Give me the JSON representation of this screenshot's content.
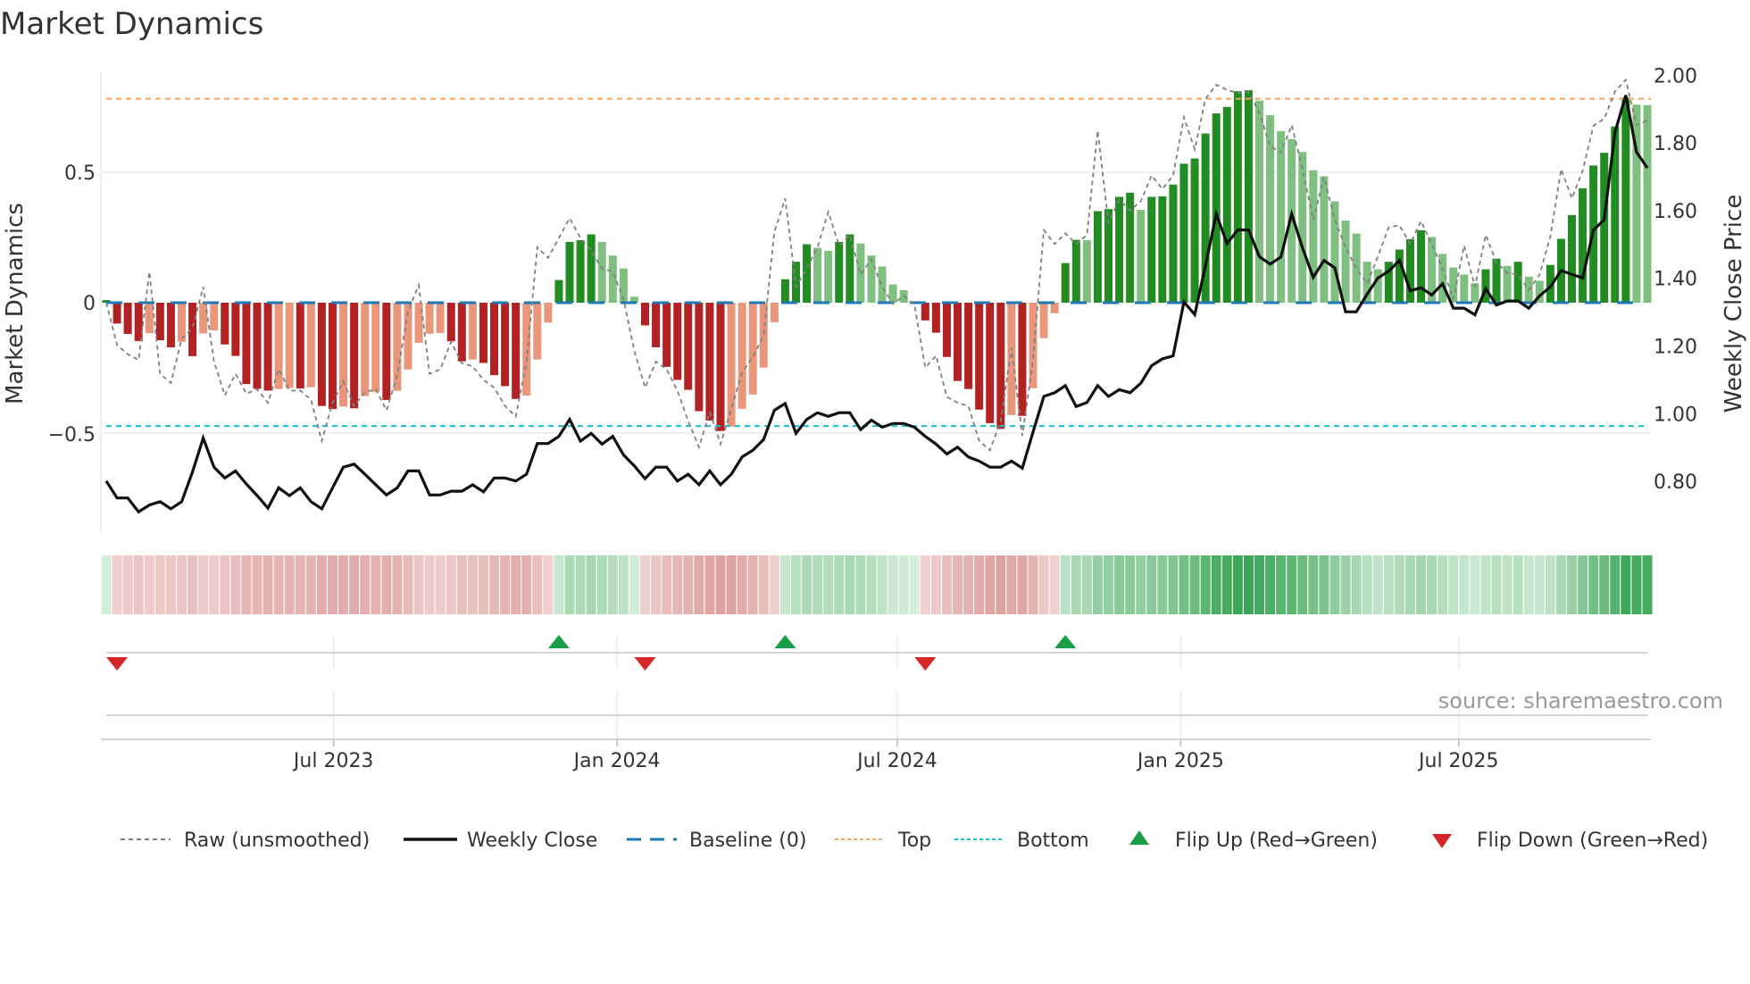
{
  "title": "Market Dynamics",
  "source": "source: sharemaestro.com",
  "colors": {
    "pos_strong": "#228b22",
    "pos_weak": "#7fbf7f",
    "neg_strong": "#b22222",
    "neg_weak": "#e9967a",
    "raw": "#808080",
    "close": "#111111",
    "baseline": "#1f77b4",
    "top": "#f4a460",
    "bottom": "#17becf",
    "flip_up": "#1a9e48",
    "flip_down": "#d62728"
  },
  "chart_data": {
    "type": "bar",
    "title": "Market Dynamics",
    "ylabel": "Market Dynamics",
    "y2label": "Weekly Close Price",
    "ylim": [
      -0.82,
      0.89
    ],
    "y2lim": [
      0.64,
      2.04
    ],
    "yticks": [
      "0.5",
      "0",
      "−0.5"
    ],
    "ytick_values": [
      0.5,
      0,
      -0.5
    ],
    "y2ticks": [
      "2.00",
      "1.80",
      "1.60",
      "1.40",
      "1.20",
      "1.00",
      "0.80"
    ],
    "y2tick_values": [
      2.0,
      1.8,
      1.6,
      1.4,
      1.2,
      1.0,
      0.8
    ],
    "xticks": [
      "Jul 2023",
      "Jan 2024",
      "Jul 2024",
      "Jan 2025",
      "Jul 2025"
    ],
    "xtick_week_index": [
      21.1,
      47.4,
      73.4,
      99.7,
      125.5
    ],
    "top_level": 0.782,
    "bottom_level": -0.473,
    "baseline": 0,
    "dynamics": [
      0.01,
      -0.08,
      -0.12,
      -0.147,
      -0.117,
      -0.144,
      -0.171,
      -0.15,
      -0.205,
      -0.118,
      -0.106,
      -0.16,
      -0.204,
      -0.312,
      -0.33,
      -0.337,
      -0.331,
      -0.327,
      -0.329,
      -0.324,
      -0.396,
      -0.408,
      -0.398,
      -0.405,
      -0.358,
      -0.343,
      -0.373,
      -0.338,
      -0.256,
      -0.154,
      -0.119,
      -0.116,
      -0.148,
      -0.225,
      -0.218,
      -0.231,
      -0.278,
      -0.32,
      -0.369,
      -0.356,
      -0.218,
      -0.076,
      0.087,
      0.233,
      0.24,
      0.262,
      0.233,
      0.181,
      0.131,
      0.023,
      -0.087,
      -0.171,
      -0.246,
      -0.296,
      -0.334,
      -0.416,
      -0.452,
      -0.492,
      -0.475,
      -0.407,
      -0.352,
      -0.249,
      -0.075,
      0.09,
      0.157,
      0.224,
      0.211,
      0.199,
      0.233,
      0.262,
      0.227,
      0.181,
      0.139,
      0.07,
      0.048,
      0.005,
      -0.068,
      -0.115,
      -0.208,
      -0.3,
      -0.331,
      -0.41,
      -0.462,
      -0.484,
      -0.431,
      -0.434,
      -0.328,
      -0.136,
      -0.04,
      0.152,
      0.241,
      0.24,
      0.351,
      0.359,
      0.406,
      0.422,
      0.356,
      0.406,
      0.408,
      0.453,
      0.533,
      0.553,
      0.649,
      0.726,
      0.751,
      0.811,
      0.815,
      0.775,
      0.719,
      0.658,
      0.628,
      0.578,
      0.508,
      0.485,
      0.389,
      0.315,
      0.265,
      0.157,
      0.128,
      0.157,
      0.204,
      0.244,
      0.278,
      0.252,
      0.187,
      0.135,
      0.108,
      0.075,
      0.128,
      0.169,
      0.141,
      0.157,
      0.1,
      0.084,
      0.145,
      0.245,
      0.336,
      0.439,
      0.526,
      0.575,
      0.676,
      0.787,
      0.76,
      0.758
    ],
    "raw": [
      0.0,
      -0.162,
      -0.197,
      -0.22,
      0.119,
      -0.273,
      -0.308,
      -0.138,
      -0.097,
      0.061,
      -0.226,
      -0.355,
      -0.273,
      -0.349,
      -0.331,
      -0.384,
      -0.255,
      -0.337,
      -0.337,
      -0.372,
      -0.53,
      -0.384,
      -0.302,
      -0.396,
      -0.343,
      -0.331,
      -0.413,
      -0.279,
      -0.033,
      0.067,
      -0.273,
      -0.255,
      -0.15,
      -0.232,
      -0.244,
      -0.296,
      -0.326,
      -0.396,
      -0.437,
      -0.226,
      0.213,
      0.172,
      0.248,
      0.324,
      0.248,
      0.2,
      0.131,
      0.119,
      0.014,
      -0.185,
      -0.326,
      -0.226,
      -0.255,
      -0.337,
      -0.454,
      -0.554,
      -0.419,
      -0.542,
      -0.407,
      -0.267,
      -0.208,
      -0.126,
      0.272,
      0.4,
      0.061,
      0.131,
      0.213,
      0.348,
      0.219,
      0.26,
      0.108,
      0.166,
      0.061,
      -0.004,
      0.026,
      -0.01,
      -0.249,
      -0.203,
      -0.361,
      -0.384,
      -0.396,
      -0.53,
      -0.566,
      -0.454,
      -0.173,
      -0.51,
      -0.22,
      0.278,
      0.225,
      0.266,
      0.225,
      0.26,
      0.66,
      0.307,
      0.395,
      0.354,
      0.389,
      0.488,
      0.436,
      0.488,
      0.711,
      0.588,
      0.781,
      0.836,
      0.816,
      0.804,
      0.81,
      0.728,
      0.6,
      0.576,
      0.681,
      0.512,
      0.318,
      0.482,
      0.318,
      0.213,
      0.131,
      0.073,
      0.178,
      0.289,
      0.297,
      0.225,
      0.313,
      0.225,
      0.131,
      0.014,
      0.219,
      0.061,
      0.26,
      0.155,
      0.114,
      0.108,
      0.049,
      0.108,
      0.254,
      0.512,
      0.4,
      0.506,
      0.679,
      0.705,
      0.81,
      0.855,
      0.681,
      0.699
    ],
    "close": [
      0.801,
      0.751,
      0.751,
      0.71,
      0.73,
      0.74,
      0.719,
      0.74,
      0.828,
      0.928,
      0.842,
      0.81,
      0.831,
      0.792,
      0.758,
      0.721,
      0.781,
      0.758,
      0.781,
      0.74,
      0.719,
      0.781,
      0.842,
      0.851,
      0.821,
      0.79,
      0.76,
      0.781,
      0.831,
      0.831,
      0.76,
      0.76,
      0.771,
      0.771,
      0.79,
      0.769,
      0.81,
      0.81,
      0.801,
      0.821,
      0.912,
      0.912,
      0.933,
      0.983,
      0.919,
      0.942,
      0.91,
      0.933,
      0.878,
      0.846,
      0.808,
      0.842,
      0.842,
      0.801,
      0.821,
      0.79,
      0.831,
      0.79,
      0.821,
      0.872,
      0.892,
      0.924,
      1.01,
      1.03,
      0.942,
      0.983,
      1.003,
      0.992,
      1.003,
      1.003,
      0.953,
      0.981,
      0.96,
      0.971,
      0.971,
      0.96,
      0.933,
      0.91,
      0.881,
      0.901,
      0.872,
      0.86,
      0.842,
      0.842,
      0.86,
      0.839,
      0.946,
      1.051,
      1.062,
      1.083,
      1.021,
      1.033,
      1.083,
      1.051,
      1.071,
      1.062,
      1.09,
      1.142,
      1.162,
      1.171,
      1.33,
      1.293,
      1.437,
      1.59,
      1.503,
      1.543,
      1.543,
      1.464,
      1.442,
      1.463,
      1.59,
      1.49,
      1.403,
      1.453,
      1.431,
      1.301,
      1.301,
      1.353,
      1.401,
      1.421,
      1.453,
      1.363,
      1.372,
      1.351,
      1.384,
      1.312,
      1.312,
      1.292,
      1.369,
      1.321,
      1.333,
      1.333,
      1.312,
      1.348,
      1.375,
      1.423,
      1.412,
      1.401,
      1.543,
      1.573,
      1.832,
      1.941,
      1.773,
      1.726
    ],
    "flip_up_week_index": [
      42,
      63,
      89
    ],
    "flip_down_week_index": [
      1,
      50,
      76
    ],
    "legend": {
      "placement": "bottom",
      "items": [
        "Raw (unsmoothed)",
        "Weekly Close",
        "Baseline (0)",
        "Top",
        "Bottom",
        "Flip Up (Red→Green)",
        "Flip Down (Green→Red)"
      ]
    }
  }
}
